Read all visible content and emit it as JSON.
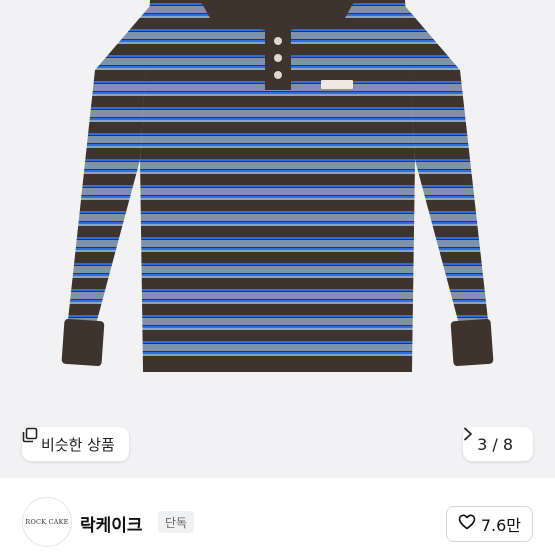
{
  "image": {
    "alt": "",
    "colors": {
      "background": "#f2f2f4",
      "stripe_brown": "#3f332d",
      "stripe_blue": "#7c92ad",
      "accent_blue": "#2f6ee0"
    }
  },
  "similar_button": {
    "label": "비슷한 상품",
    "icon": "copy-icon"
  },
  "pager": {
    "text": "3 / 8",
    "icon": "chevron-right-icon"
  },
  "seller": {
    "logo_text": "ROCK CAKE",
    "name": "락케이크",
    "badge": "단독"
  },
  "like": {
    "count": "7.6만",
    "icon": "heart-icon"
  }
}
